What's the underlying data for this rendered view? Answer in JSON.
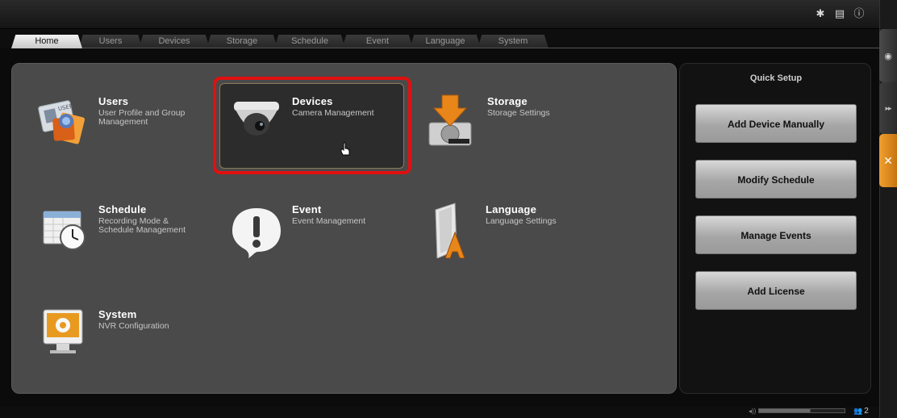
{
  "topbar": {
    "icons": [
      "gear-icon",
      "document-icon",
      "info-icon"
    ],
    "gear_glyph": "✱",
    "doc_glyph": "▤",
    "info_glyph": "ⓘ"
  },
  "tabs": [
    {
      "label": "Home",
      "active": true
    },
    {
      "label": "Users"
    },
    {
      "label": "Devices"
    },
    {
      "label": "Storage"
    },
    {
      "label": "Schedule"
    },
    {
      "label": "Event"
    },
    {
      "label": "Language"
    },
    {
      "label": "System"
    }
  ],
  "rail": {
    "eye_glyph": "◉",
    "ff_glyph": "▸▸",
    "tools_glyph": "✕"
  },
  "items": {
    "users": {
      "title": "Users",
      "desc": "User Profile and Group Management"
    },
    "devices": {
      "title": "Devices",
      "desc": "Camera Management"
    },
    "storage": {
      "title": "Storage",
      "desc": "Storage Settings"
    },
    "schedule": {
      "title": "Schedule",
      "desc": "Recording Mode & Schedule Management"
    },
    "event": {
      "title": "Event",
      "desc": "Event Management"
    },
    "language": {
      "title": "Language",
      "desc": "Language Settings"
    },
    "system": {
      "title": "System",
      "desc": "NVR Configuration"
    }
  },
  "quick_setup": {
    "title": "Quick Setup",
    "buttons": {
      "add_device": "Add Device Manually",
      "modify_schedule": "Modify Schedule",
      "manage_events": "Manage Events",
      "add_license": "Add License"
    }
  },
  "status": {
    "speaker_glyph": "◂))",
    "users_glyph": "👥",
    "user_count": "2"
  },
  "colors": {
    "accent_orange": "#e08a18",
    "highlight_red": "#e01010"
  }
}
